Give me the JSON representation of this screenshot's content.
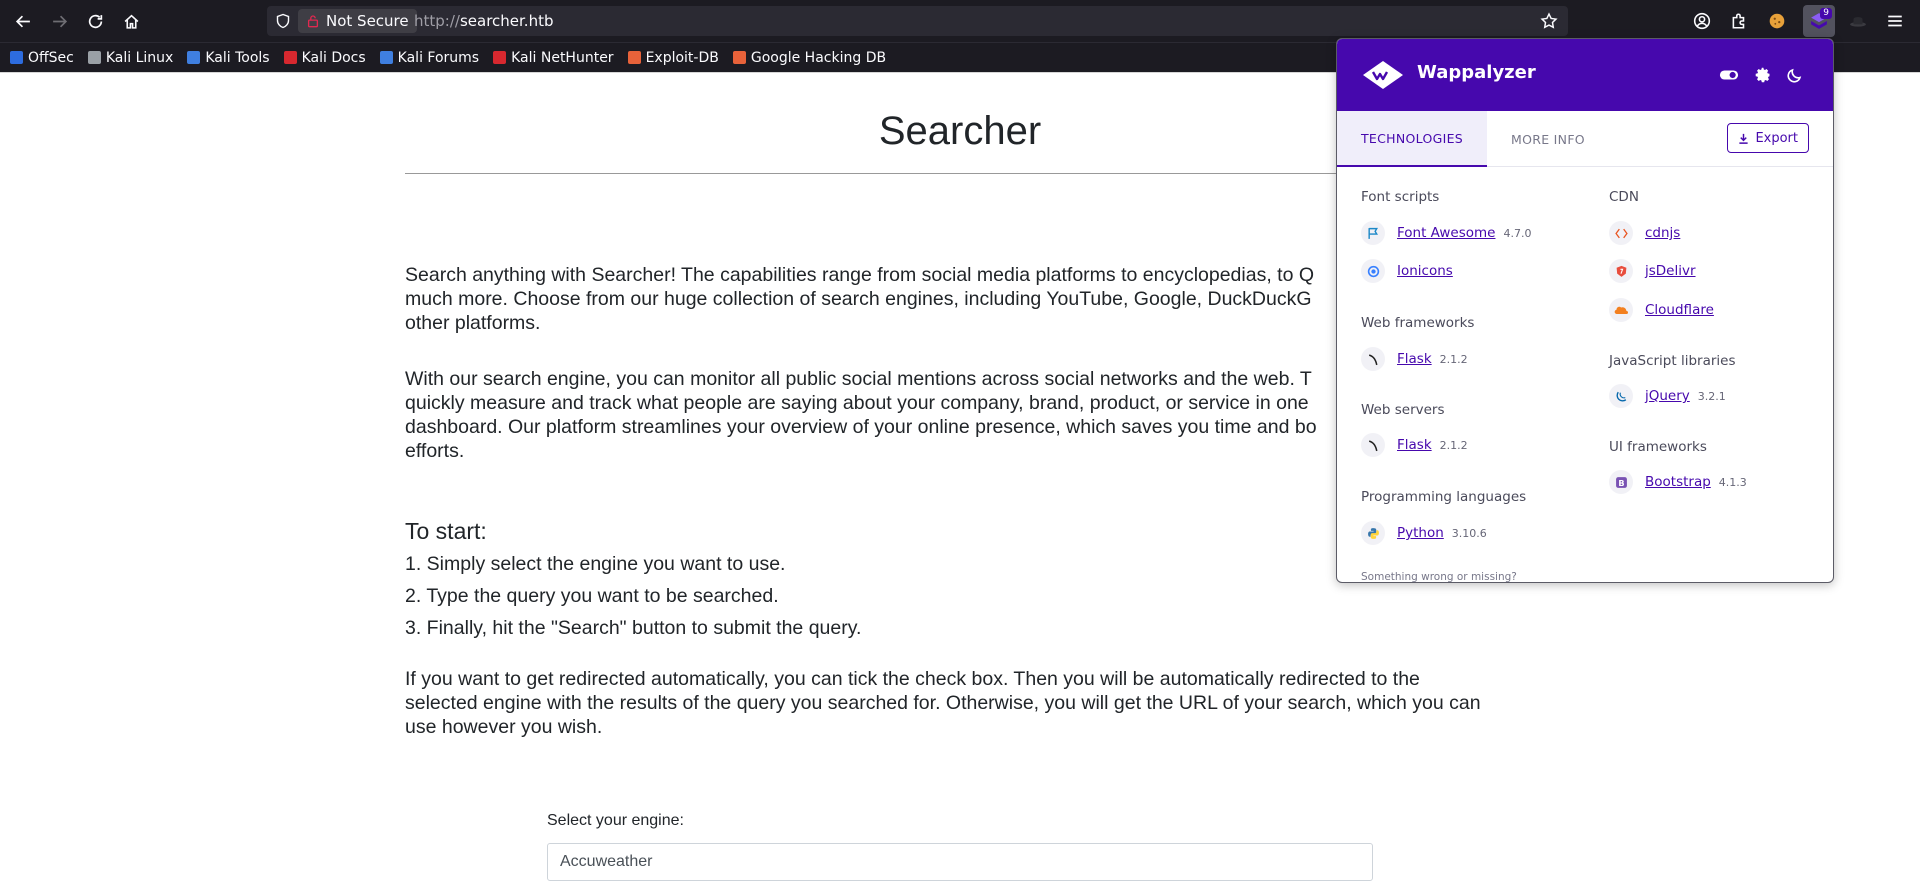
{
  "browser": {
    "security_label": "Not Secure",
    "url_scheme": "http://",
    "url_host": "searcher.htb",
    "extension_badge": "9",
    "bookmarks": [
      {
        "label": "OffSec",
        "color": "#2d6cdf"
      },
      {
        "label": "Kali Linux",
        "color": "#9aa0a6"
      },
      {
        "label": "Kali Tools",
        "color": "#3f7fe0"
      },
      {
        "label": "Kali Docs",
        "color": "#d7282f"
      },
      {
        "label": "Kali Forums",
        "color": "#3f7fe0"
      },
      {
        "label": "Kali NetHunter",
        "color": "#d7282f"
      },
      {
        "label": "Exploit-DB",
        "color": "#e8623a"
      },
      {
        "label": "Google Hacking DB",
        "color": "#e8623a"
      }
    ]
  },
  "page": {
    "title": "Searcher",
    "intro_1": "Search anything with Searcher! The capabilities range from social media platforms to encyclopedias, to Q",
    "intro_2": "much more. Choose from our huge collection of search engines, including YouTube, Google, DuckDuckG",
    "intro_3": "other platforms.",
    "monitor_1": "With our search engine, you can monitor all public social mentions across social networks and the web. T",
    "monitor_2": "quickly measure and track what people are saying about your company, brand, product, or service in one",
    "monitor_3": "dashboard. Our platform streamlines your overview of your online presence, which saves you time and bo",
    "monitor_4": "efforts.",
    "start_heading": "To start:",
    "steps": [
      "1. Simply select the engine you want to use.",
      "2. Type the query you want to be searched.",
      "3. Finally, hit the \"Search\" button to submit the query."
    ],
    "redirect_1": "If you want to get redirected automatically, you can tick the check box. Then you will be automatically redirected to the",
    "redirect_2": "selected engine with the results of the query you searched for. Otherwise, you will get the URL of your search, which you can",
    "redirect_3": "use however you wish.",
    "engine_label": "Select your engine:",
    "engine_value": "Accuweather"
  },
  "wappalyzer": {
    "name": "Wappalyzer",
    "tab_technologies": "TECHNOLOGIES",
    "tab_more_info": "MORE INFO",
    "export_label": "Export",
    "footer": "Something wrong or missing?",
    "left": [
      {
        "category": "Font scripts",
        "items": [
          {
            "name": "Font Awesome",
            "version": "4.7.0",
            "icon": "flag-icon",
            "color": "#1c88c7"
          },
          {
            "name": "Ionicons",
            "version": "",
            "icon": "ionicons-icon",
            "color": "#3880ff"
          }
        ]
      },
      {
        "category": "Web frameworks",
        "items": [
          {
            "name": "Flask",
            "version": "2.1.2",
            "icon": "flask-icon",
            "color": "#222222"
          }
        ]
      },
      {
        "category": "Web servers",
        "items": [
          {
            "name": "Flask",
            "version": "2.1.2",
            "icon": "flask-icon",
            "color": "#222222"
          }
        ]
      },
      {
        "category": "Programming languages",
        "items": [
          {
            "name": "Python",
            "version": "3.10.6",
            "icon": "python-icon",
            "color": "#3776ab"
          }
        ]
      }
    ],
    "right": [
      {
        "category": "CDN",
        "items": [
          {
            "name": "cdnjs",
            "version": "",
            "icon": "cdnjs-icon",
            "color": "#e95420"
          },
          {
            "name": "jsDelivr",
            "version": "",
            "icon": "jsdelivr-icon",
            "color": "#e84d3d"
          },
          {
            "name": "Cloudflare",
            "version": "",
            "icon": "cloudflare-icon",
            "color": "#f38020"
          }
        ]
      },
      {
        "category": "JavaScript libraries",
        "items": [
          {
            "name": "jQuery",
            "version": "3.2.1",
            "icon": "jquery-icon",
            "color": "#0769ad"
          }
        ]
      },
      {
        "category": "UI frameworks",
        "items": [
          {
            "name": "Bootstrap",
            "version": "4.1.3",
            "icon": "bootstrap-icon",
            "color": "#7952b3"
          }
        ]
      }
    ]
  }
}
